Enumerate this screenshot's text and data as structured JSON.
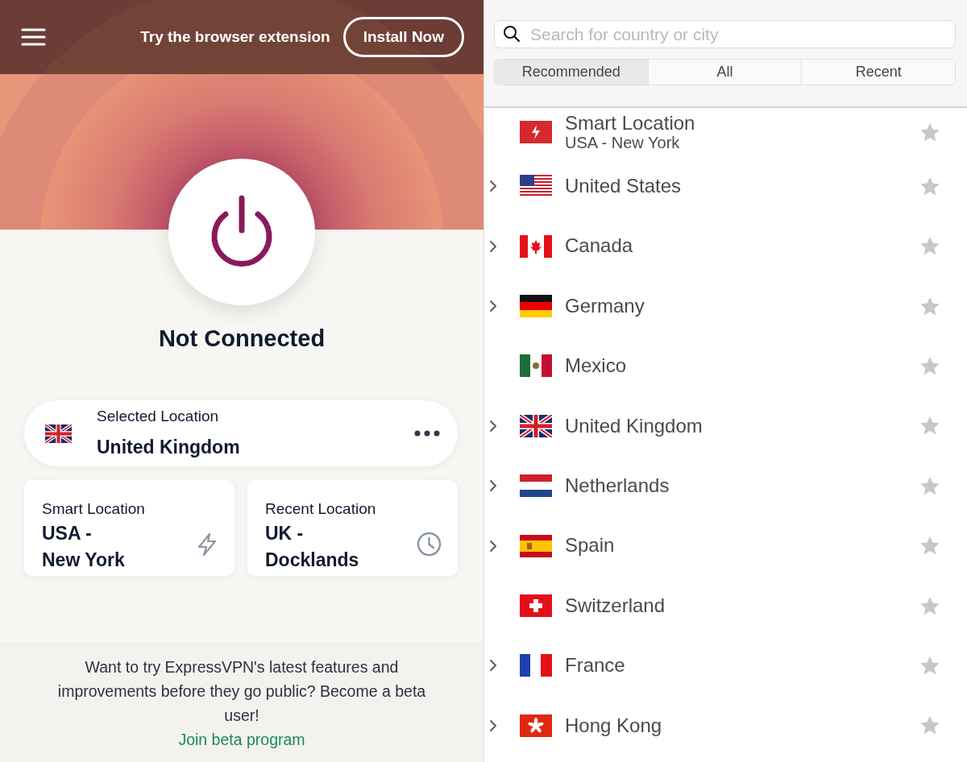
{
  "banner": {
    "text": "Try the browser extension",
    "button": "Install Now"
  },
  "status": "Not Connected",
  "selected_location": {
    "kind": "gb",
    "label": "Selected Location",
    "value": "United Kingdom"
  },
  "shortcuts": [
    {
      "kind": "smart",
      "label": "Smart Location",
      "lines": [
        "USA -",
        "New York"
      ]
    },
    {
      "kind": "recent",
      "label": "Recent Location",
      "lines": [
        "UK -",
        "Docklands"
      ]
    }
  ],
  "beta": {
    "text": "Want to try ExpressVPN's latest features and improvements before they go public? Become a beta user!",
    "link": "Join beta program"
  },
  "search": {
    "placeholder": "Search for country or city"
  },
  "tabs": [
    {
      "label": "Recommended",
      "selected": true
    },
    {
      "label": "All",
      "selected": false
    },
    {
      "label": "Recent",
      "selected": false
    }
  ],
  "locations": [
    {
      "kind": "smart",
      "name": "Smart Location",
      "sub": "USA - New York",
      "expandable": false,
      "favorite": false
    },
    {
      "kind": "us",
      "name": "United States",
      "expandable": true,
      "favorite": false
    },
    {
      "kind": "ca",
      "name": "Canada",
      "expandable": true,
      "favorite": false
    },
    {
      "kind": "de",
      "name": "Germany",
      "expandable": true,
      "favorite": false
    },
    {
      "kind": "mx",
      "name": "Mexico",
      "expandable": false,
      "favorite": false
    },
    {
      "kind": "gb",
      "name": "United Kingdom",
      "expandable": true,
      "favorite": false
    },
    {
      "kind": "nl",
      "name": "Netherlands",
      "expandable": true,
      "favorite": false
    },
    {
      "kind": "es",
      "name": "Spain",
      "expandable": true,
      "favorite": false
    },
    {
      "kind": "ch",
      "name": "Switzerland",
      "expandable": false,
      "favorite": false
    },
    {
      "kind": "fr",
      "name": "France",
      "expandable": true,
      "favorite": false
    },
    {
      "kind": "hk",
      "name": "Hong Kong",
      "expandable": true,
      "favorite": false
    }
  ]
}
